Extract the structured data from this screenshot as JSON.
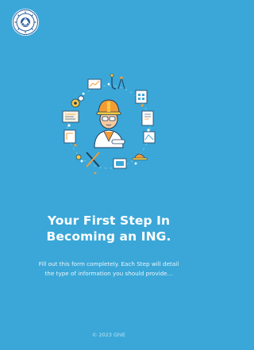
{
  "hero": {
    "title_line1": "Your First Step In",
    "title_line2": "Becoming an ING.",
    "subtitle_line1": "Fill out this form completely. Each Step will detail",
    "subtitle_line2": "the type of information you should provide..."
  },
  "footer": {
    "copyright": "© 2023 GhIE"
  },
  "icons": {
    "logo": "ghie-seal-logo",
    "illustration": "engineer-with-tools-illustration"
  },
  "colors": {
    "background": "#3aa7d8",
    "accent_orange": "#f39c34",
    "accent_yellow": "#f7c843",
    "accent_navy": "#1d3f5f"
  }
}
